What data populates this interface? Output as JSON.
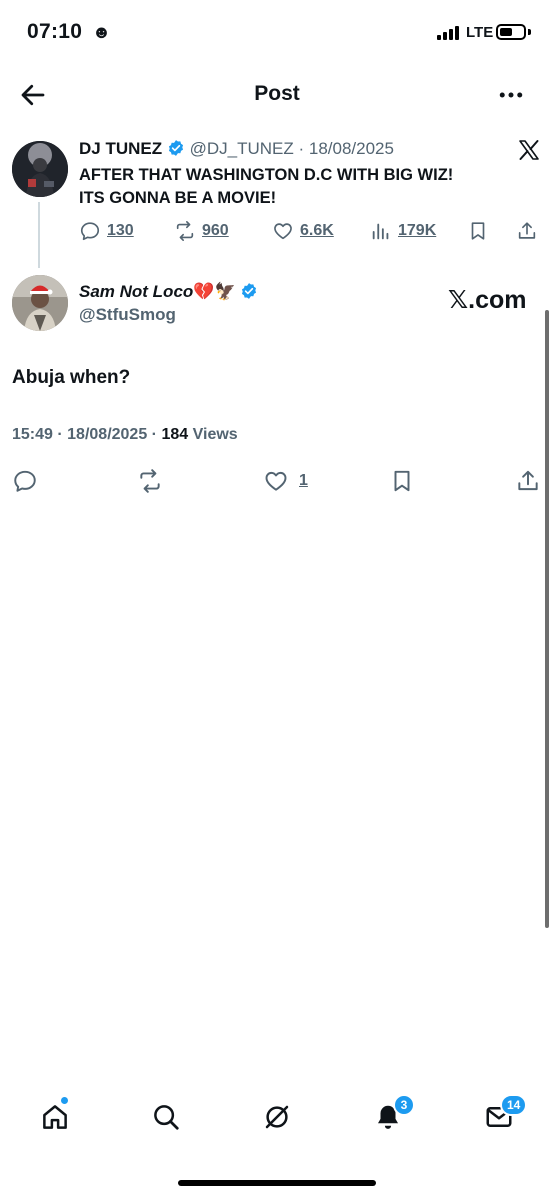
{
  "status_bar": {
    "time": "07:10",
    "smiley": "☻",
    "network": "LTE",
    "battery_level": 0.55
  },
  "header": {
    "title": "Post",
    "back_icon": "arrow-left-icon",
    "more_icon": "more-horizontal-icon"
  },
  "parent_post": {
    "name": "DJ TUNEZ",
    "handle": "@DJ_TUNEZ",
    "date": "· 18/08/2025",
    "text_line1": "AFTER THAT WASHINGTON D.C WITH BIG WIZ!",
    "text_line2": "ITS GONNA BE A MOVIE!",
    "replies": "130",
    "reposts": "960",
    "likes": "6.6K",
    "views": "179K"
  },
  "reply_post": {
    "name": "Sam Not Loco",
    "name_emojis": "💔🦅",
    "handle": "@StfuSmog",
    "watermark": "𝕏.com",
    "text": "Abuja when?",
    "time": "15:49",
    "date": "· 18/08/2025 ·",
    "views_count": "184",
    "views_label": "Views",
    "likes": "1"
  },
  "bottom_nav": {
    "notifications_badge": "3",
    "messages_badge": "14"
  },
  "colors": {
    "accent": "#1d9bf0",
    "text": "#0f1419",
    "muted": "#536471"
  }
}
